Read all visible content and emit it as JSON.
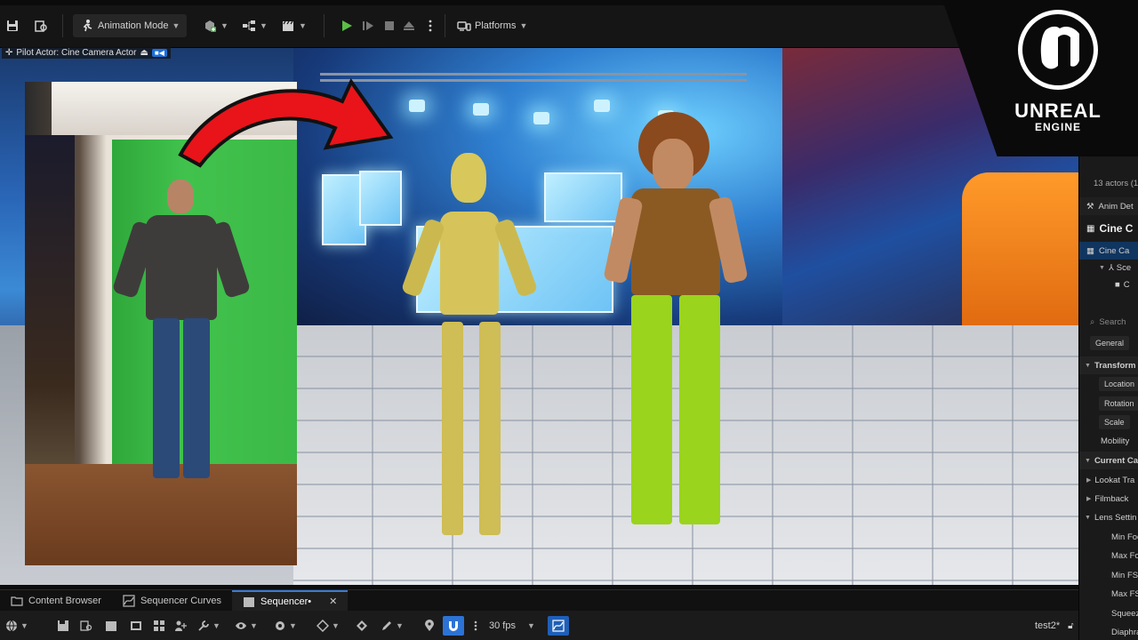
{
  "toolbar": {
    "mode_label": "Animation Mode",
    "platforms_label": "Platforms"
  },
  "viewport": {
    "pilot_label": "Pilot Actor: Cine Camera Actor"
  },
  "logo": {
    "word": "UNREAL",
    "sub": "ENGINE"
  },
  "right_panel": {
    "actors_count": "13 actors (1",
    "anim_details": "Anim Det",
    "cine_header": "Cine C",
    "cine_cam": "Cine Ca",
    "scene": "Sce",
    "camera": "C",
    "search_placeholder": "Search",
    "general": "General",
    "transform": "Transform",
    "location": "Location",
    "rotation": "Rotation",
    "scale": "Scale",
    "mobility": "Mobility",
    "current_camera": "Current Cam",
    "lookat": "Lookat Tra",
    "filmback": "Filmback",
    "lens_settings": "Lens Settin",
    "min_focal": "Min Foc",
    "max_focal": "Max Foc",
    "min_fstop": "Min FSt",
    "max_fstop": "Max FS",
    "squeeze": "Squeeze",
    "diaphragm": "Diaphra"
  },
  "tabs": [
    {
      "label": "Content Browser"
    },
    {
      "label": "Sequencer Curves"
    },
    {
      "label": "Sequencer•"
    }
  ],
  "sequencer": {
    "fps": "30 fps",
    "sequence_name": "test2*"
  },
  "colors": {
    "accent_blue": "#2c73d6",
    "green_screen": "#3cb947",
    "arrow_red": "#e8141a"
  }
}
